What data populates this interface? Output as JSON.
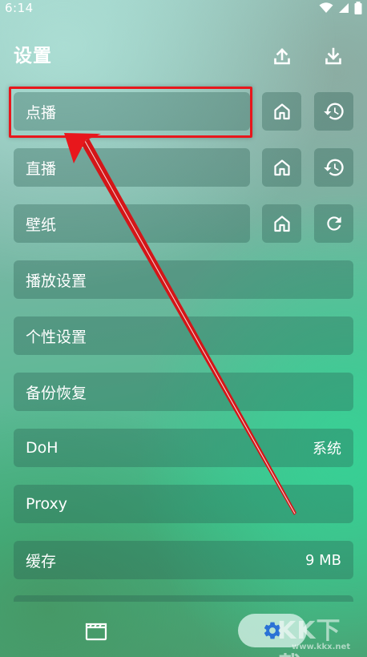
{
  "status_bar": {
    "time": "6:14"
  },
  "header": {
    "title": "设置"
  },
  "rows": [
    {
      "label": "点播"
    },
    {
      "label": "直播"
    },
    {
      "label": "壁纸"
    },
    {
      "label": "播放设置"
    },
    {
      "label": "个性设置"
    },
    {
      "label": "备份恢复"
    },
    {
      "label": "DoH",
      "value": "系统"
    },
    {
      "label": "Proxy"
    },
    {
      "label": "缓存",
      "value": "9 MB"
    }
  ],
  "icons": {
    "upload": "upload-icon",
    "download": "download-icon",
    "home": "home-icon",
    "history": "history-icon",
    "refresh": "refresh-icon",
    "vod": "clapperboard-icon",
    "settings": "gear-icon"
  },
  "annotation": {
    "highlight_color": "#e8171c"
  },
  "watermark": {
    "big": "KK下载",
    "small": "www.kkx.net"
  }
}
